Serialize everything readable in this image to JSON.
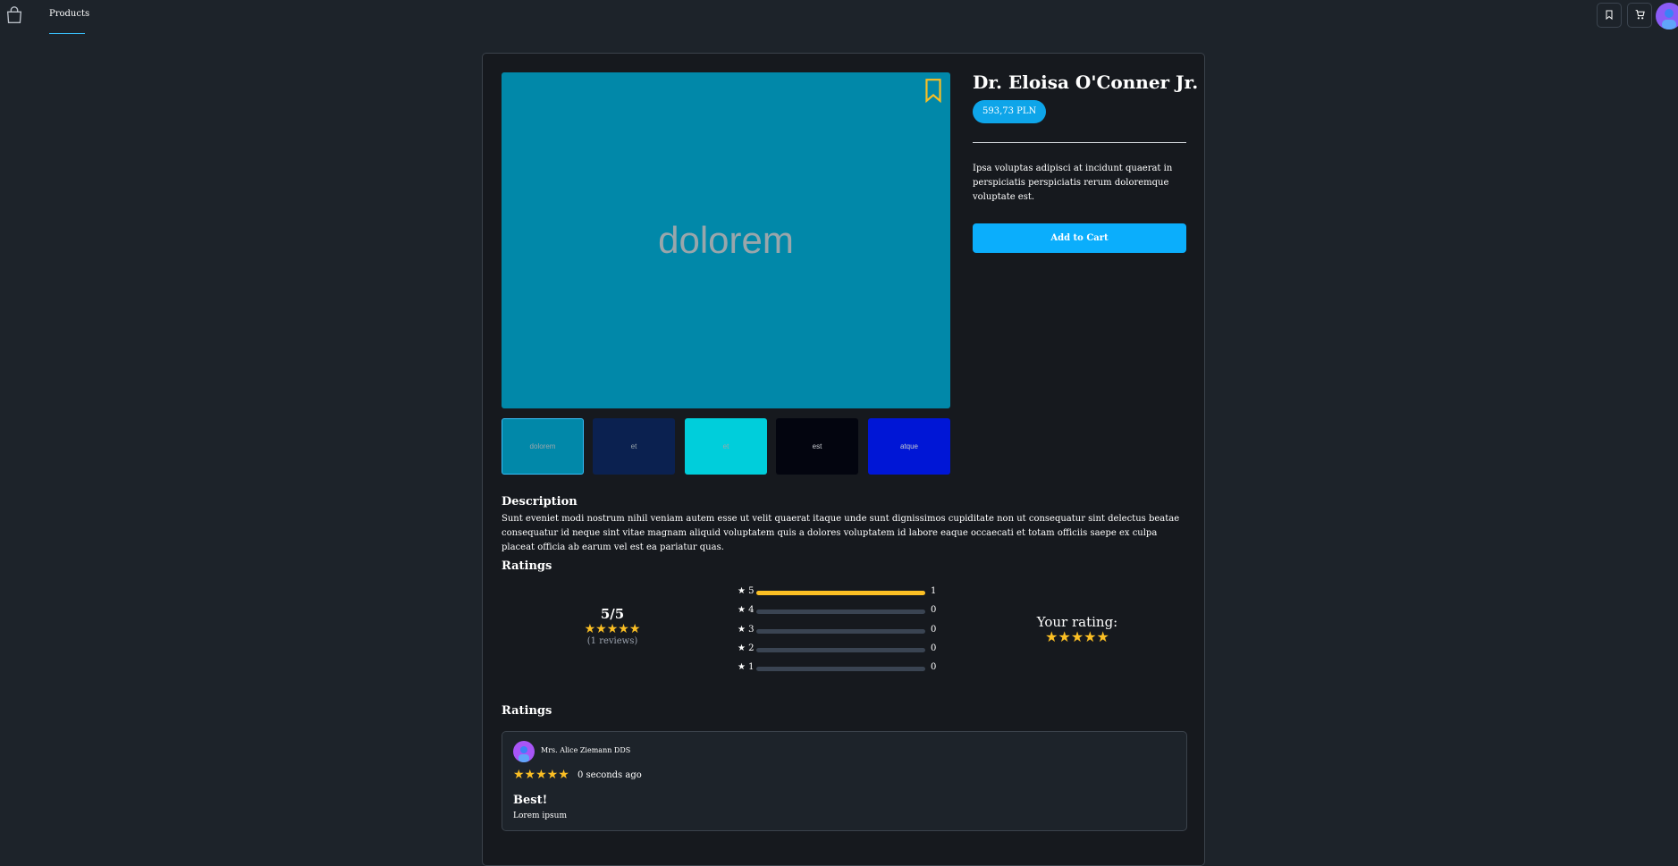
{
  "nav": {
    "tab_label": "Products"
  },
  "product": {
    "title": "Dr. Eloisa O'Conner Jr.",
    "price": "593,73 PLN",
    "short_description": "Ipsa voluptas adipisci at incidunt quaerat in perspiciatis perspiciatis rerum doloremque voluptate est.",
    "add_to_cart": "Add to Cart",
    "main_image_text": "dolorem",
    "main_image_color": "#0188a9",
    "thumbnails": [
      {
        "label": "dolorem",
        "bg": "#0188a9",
        "fg": "#9aa6ab"
      },
      {
        "label": "et",
        "bg": "#0b2150",
        "fg": "#9aa6ab"
      },
      {
        "label": "et",
        "bg": "#00cedb",
        "fg": "#9aa6ab"
      },
      {
        "label": "est",
        "bg": "#03050f",
        "fg": "#c6cacf"
      },
      {
        "label": "atque",
        "bg": "#0016d6",
        "fg": "#c6cacf"
      }
    ]
  },
  "description": {
    "heading": "Description",
    "text": "Sunt eveniet modi nostrum nihil veniam autem esse ut velit quaerat itaque unde sunt dignissimos cupiditate non ut consequatur sint delectus beatae consequatur id neque sint vitae magnam aliquid voluptatem quis a dolores voluptatem id labore eaque occaecati et totam officiis saepe ex culpa placeat officia ab earum vel est ea pariatur quas."
  },
  "ratings": {
    "heading": "Ratings",
    "average": "5/5",
    "average_stars": "★★★★★",
    "count": "(1 reviews)",
    "distribution": [
      {
        "label": "★ 5",
        "count": "1",
        "fill": 1.0
      },
      {
        "label": "★ 4",
        "count": "0",
        "fill": 0.0
      },
      {
        "label": "★ 3",
        "count": "0",
        "fill": 0.0
      },
      {
        "label": "★ 2",
        "count": "0",
        "fill": 0.0
      },
      {
        "label": "★ 1",
        "count": "0",
        "fill": 0.0
      }
    ],
    "your_rating_label": "Your rating:",
    "your_rating_stars": "★★★★★"
  },
  "reviews": {
    "heading": "Ratings",
    "items": [
      {
        "author": "Mrs. Alice Ziemann DDS",
        "stars": "★★★★★",
        "time": "0 seconds ago",
        "title": "Best!",
        "body": "Lorem ipsum"
      }
    ]
  },
  "colors": {
    "accent": "#0baefc",
    "star": "#fbbf24",
    "background": "#1d232a",
    "card": "#16191e"
  },
  "icons": {
    "logo": "shopping-bag-icon",
    "wishlist": "bookmark-icon",
    "cart": "cart-icon"
  }
}
